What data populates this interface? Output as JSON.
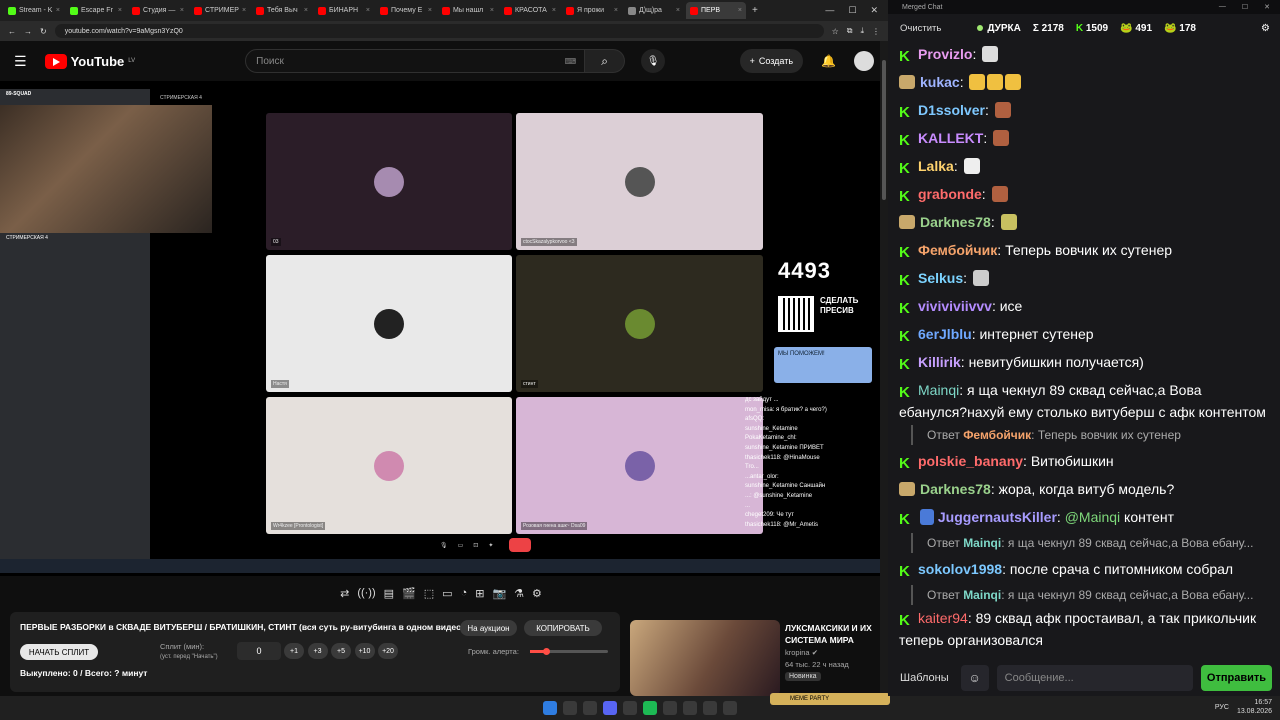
{
  "browser": {
    "tabs": [
      {
        "label": "Stream - K",
        "color": "#53fc18"
      },
      {
        "label": "Escape Fr",
        "color": "#53fc18"
      },
      {
        "label": "Студия —",
        "color": "#ff0000"
      },
      {
        "label": "СТРИМЕР",
        "color": "#ff0000"
      },
      {
        "label": "Тебя Выч",
        "color": "#ff0000"
      },
      {
        "label": "БИНАРН",
        "color": "#ff0000"
      },
      {
        "label": "Почему Е",
        "color": "#ff0000"
      },
      {
        "label": "Мы нашл",
        "color": "#ff0000"
      },
      {
        "label": "КРАСОТА",
        "color": "#ff0000"
      },
      {
        "label": "Я прожи",
        "color": "#ff0000"
      },
      {
        "label": "Д)щ)ра",
        "color": "#888888"
      },
      {
        "label": "ПЕРВ",
        "color": "#ff0000"
      }
    ],
    "url": "youtube.com/watch?v=9aMgsn3YzQ0"
  },
  "youtube": {
    "logo_text": "YouTube",
    "region": "LV",
    "search_placeholder": "Поиск",
    "create_label": "Создать"
  },
  "video": {
    "discord_server": "89-SQUAD",
    "channel": "СТРИМЕРСКАЯ 4",
    "tiles": [
      "03",
      "ctocSkazalypkorvoo <3",
      "Настя",
      "стинт",
      "Wr4kzee [Prontologist]",
      "Розовая гиена ашк~ Dsa09"
    ],
    "counter": "4493",
    "presiv": "СДЕЛАТЬ ПРЕСИВ",
    "help": "МЫ ПОМОЖЕМ!",
    "stream_chat": [
      "дс зайдут ...",
      "mon_misa: я братик? а чего?)",
      "afsQQ:",
      "sunshine_Ketamine",
      "PokaKetamine_chl:",
      "sunshine_Ketamine ПРИВЕТ",
      "thasichek118: @HinaMouse",
      "Tro...",
      "...antar_olor:",
      "sunshine_Ketamine Саншайн",
      "...: @sunshine_Ketamine",
      "...",
      "cheget209: Че тут",
      "thasichek118: @Mr_Ametis"
    ]
  },
  "tools": [
    "⇄",
    "((·))",
    "▤",
    "🎬",
    "⬚",
    "▭",
    "◔",
    "⊞",
    "📷",
    "⚗",
    "⚙"
  ],
  "panel": {
    "title": "ПЕРВЫЕ РАЗБОРКИ в СКВАДЕ ВИТУБЕРШ / БРАТИШКИН, СТИНТ (вся суть ру-витубинга в одном видео)",
    "auction": "На аукцион",
    "copy": "КОПИРОВАТЬ",
    "start_split": "НАЧАТЬ СПЛИТ",
    "split_label": "Сплит (мин):",
    "split_hint": "(уст. перед \"Начать\")",
    "split_value": "0",
    "steps": [
      "+1",
      "+3",
      "+5",
      "+10",
      "+20"
    ],
    "alert_volume_label": "Громк. алерта:",
    "alert_volume": 0.2,
    "bought": "Выкуплено: 0 / Всего: ? минут"
  },
  "recommended": {
    "title": "ЛУКСМАКСИКИ И ИХ СИСТЕМА МИРА",
    "channel": "kropina",
    "meta": "64 тыс.  22 ч назад",
    "badge": "Новинка",
    "meme": "MEME PARTY"
  },
  "os": {
    "lang": "РУС",
    "time": "16:57",
    "date": "13.08.2026"
  },
  "chat": {
    "window_title": "Merged Chat",
    "clear": "Очистить",
    "streamer": "ДУРКА",
    "total": "Σ 2178",
    "kick_count": "1509",
    "tw_count": "491",
    "yt_count": "178",
    "messages": [
      {
        "badge": "K",
        "user": "Provizlo",
        "color": "#e89cf0",
        "text": "",
        "emotes": [
          "#ddd"
        ]
      },
      {
        "badge": "img",
        "user": "kukac",
        "color": "#9fb4ff",
        "text": "",
        "emotes": [
          "#f0c040",
          "#f0c040",
          "#f0c040"
        ]
      },
      {
        "badge": "K",
        "user": "D1ssolver",
        "color": "#7ec8ff",
        "text": "",
        "emotes": [
          "#b06040"
        ]
      },
      {
        "badge": "K",
        "user": "KALLEKT",
        "color": "#c98cff",
        "text": "",
        "emotes": [
          "#b06040"
        ]
      },
      {
        "badge": "K",
        "user": "Lalka",
        "color": "#ffd36e",
        "text": "",
        "emotes": [
          "#eee"
        ]
      },
      {
        "badge": "K",
        "user": "grabonde",
        "color": "#ff6b6b",
        "text": "",
        "emotes": [
          "#b06040"
        ]
      },
      {
        "badge": "img",
        "user": "Darknes78",
        "color": "#9ad18c",
        "text": "",
        "emotes": [
          "#c8c060"
        ]
      },
      {
        "badge": "K",
        "user": "Фембойчик",
        "color": "#f5a36b",
        "text": "Теперь вовчик их сутенер",
        "emotes": []
      },
      {
        "badge": "K",
        "user": "Selkus",
        "color": "#7cd3ff",
        "text": "",
        "emotes": [
          "#ccc"
        ]
      },
      {
        "badge": "K",
        "user": "viviviviivvv",
        "color": "#b48cff",
        "text": "исе",
        "emotes": []
      },
      {
        "badge": "K",
        "user": "6erJlblu",
        "color": "#6fa8ff",
        "text": "интернет сутенер",
        "emotes": []
      },
      {
        "badge": "K",
        "user": "Killirik",
        "color": "#c7a0ff",
        "text": "невитубишкин получается)",
        "emotes": []
      }
    ],
    "long1": {
      "user": "Mainqi",
      "color": "#7ed8c8",
      "text": "я ща чекнул 89 сквад сейчас,а Вова ебанулся?нахуй ему столько витуберш с афк контентом"
    },
    "reply1": {
      "prefix": "Ответ",
      "user": "Фембойчик",
      "text": "Теперь вовчик их сутенер"
    },
    "m2": {
      "user": "polskie_banany",
      "color": "#ff6b6b",
      "text": "Витюбишкин"
    },
    "m3": {
      "user": "Darknes78",
      "color": "#9ad18c",
      "text": "жора, когда витуб модель?"
    },
    "m4": {
      "user": "JuggernautsKiller",
      "color": "#a89cff",
      "mention": "@Mainqi",
      "text": "контент"
    },
    "reply2": {
      "prefix": "Ответ",
      "user": "Mainqi",
      "text": "я ща чекнул 89 сквад сейчас,а Вова ебану..."
    },
    "m5": {
      "user": "sokolov1998",
      "color": "#7cc8ff",
      "text": "после срача с питомником собрал"
    },
    "reply3": {
      "prefix": "Ответ",
      "user": "Mainqi",
      "text": "я ща чекнул 89 сквад сейчас,а Вова ебану..."
    },
    "m6": {
      "user": "kaiter94",
      "color": "#ff6b6b",
      "text": "89 сквад афк простаивал, а так прикольчик теперь организовался"
    },
    "templates": "Шаблоны",
    "input_placeholder": "Сообщение...",
    "send": "Отправить"
  }
}
